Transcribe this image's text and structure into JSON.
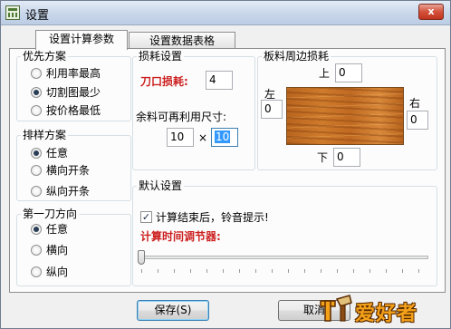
{
  "window": {
    "title": "设置",
    "close_glyph": "x"
  },
  "tabs": [
    {
      "label": "设置计算参数",
      "active": true
    },
    {
      "label": "设置数据表格",
      "active": false
    }
  ],
  "priority": {
    "legend": "优先方案",
    "options": [
      "利用率最高",
      "切割图最少",
      "按价格最低"
    ],
    "selected": 1
  },
  "layout": {
    "legend": "排样方案",
    "options": [
      "任意",
      "横向开条",
      "纵向开条"
    ],
    "selected": 0
  },
  "first_cut": {
    "legend": "第一刀方向",
    "options": [
      "任意",
      "横向",
      "纵向"
    ],
    "selected": 0
  },
  "loss": {
    "legend": "损耗设置",
    "kerf_label": "刀口损耗:",
    "kerf_value": "4",
    "remnant_label": "余料可再利用尺寸:",
    "remnant_w": "10",
    "times": "×",
    "remnant_h": "10"
  },
  "edge": {
    "legend": "板料周边损耗",
    "top_label": "上",
    "top_value": "0",
    "left_label": "左",
    "left_value": "0",
    "right_label": "右",
    "right_value": "0",
    "bottom_label": "下",
    "bottom_value": "0"
  },
  "defaults": {
    "legend": "默认设置",
    "beep_label": "计算结束后，铃音提示!",
    "beep_checked": true,
    "beep_check_glyph": "✓",
    "timer_label": "计算时间调节器:",
    "timer_level": 0
  },
  "buttons": {
    "save": "保存(S)",
    "cancel": "取消"
  },
  "watermark": {
    "text": "爱好者"
  }
}
